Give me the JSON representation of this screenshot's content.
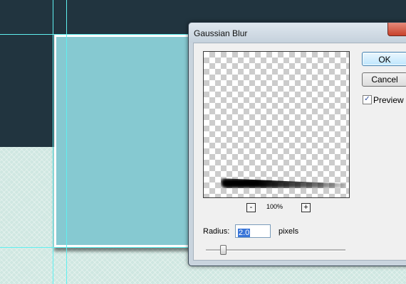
{
  "dialog": {
    "title": "Gaussian Blur",
    "ok_label": "OK",
    "cancel_label": "Cancel",
    "preview_label": "Preview",
    "preview_checked": true,
    "zoom_out_label": "-",
    "zoom_in_label": "+",
    "zoom_level": "100%",
    "radius_label": "Radius:",
    "radius_value": "2.0",
    "radius_unit": "pixels",
    "close_icon": "close-icon",
    "check_icon": "checkmark-icon"
  },
  "colors": {
    "canvas_dark": "#21343f",
    "canvas_light": "#cfe7e1",
    "card_fill": "#86c9d1",
    "guide_line": "#5ff0f0",
    "selection_highlight": "#3874d8"
  }
}
